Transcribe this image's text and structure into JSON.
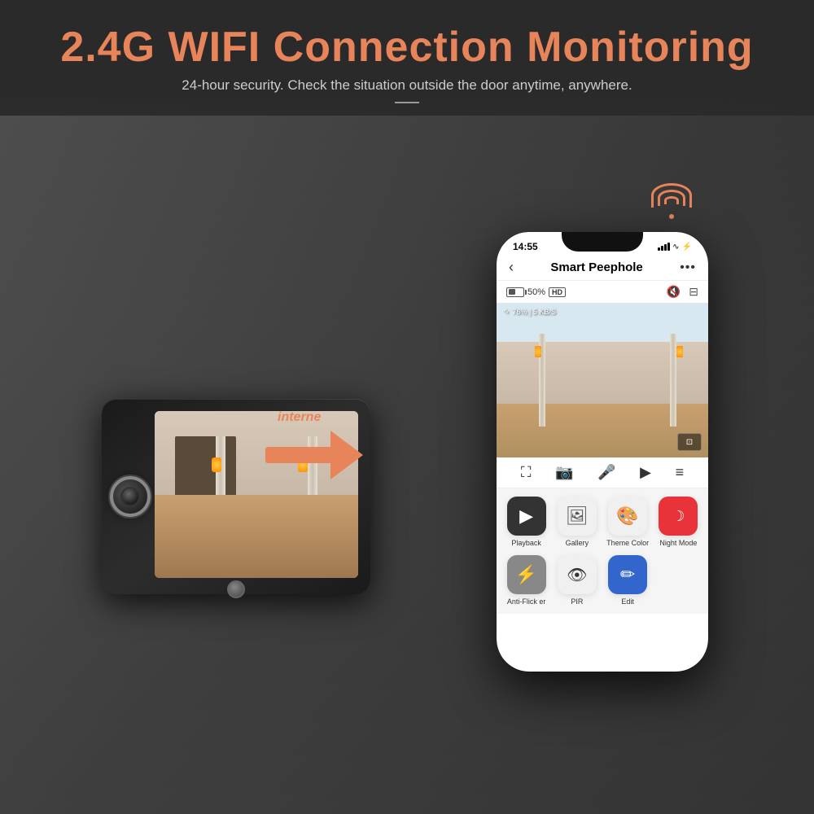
{
  "header": {
    "main_title": "2.4G WIFI Connection Monitoring",
    "subtitle": "24-hour security. Check the situation outside the door anytime, anywhere."
  },
  "arrow": {
    "label": "interne"
  },
  "phone": {
    "status_bar": {
      "time": "14:55"
    },
    "app_title": "Smart Peephole",
    "battery_percent": "50%",
    "hd_label": "HD",
    "signal_info": "76% | 5 KB/S",
    "controls": {
      "fullscreen": "⛶",
      "screenshot": "📷",
      "mic": "🎤",
      "record": "▶",
      "menu": "≡"
    },
    "app_items": [
      {
        "id": "playback",
        "label": "Playback",
        "icon": "▶",
        "icon_bg": "#333"
      },
      {
        "id": "gallery",
        "label": "Gallery",
        "icon": "🖼",
        "icon_bg": "#555"
      },
      {
        "id": "theme-color",
        "label": "Theme Color",
        "icon": "🎨",
        "icon_bg": "#ff6644"
      },
      {
        "id": "night-mode",
        "label": "Night Mode",
        "icon": "🌙",
        "icon_bg": "#e8333a"
      }
    ],
    "app_items2": [
      {
        "id": "anti-flicker",
        "label": "Anti-Flicker",
        "icon": "⚡",
        "icon_bg": "#888"
      },
      {
        "id": "pir",
        "label": "PIR",
        "icon": "👁",
        "icon_bg": "#333"
      },
      {
        "id": "edit",
        "label": "Edit",
        "icon": "✏",
        "icon_bg": "#3366cc"
      }
    ]
  }
}
